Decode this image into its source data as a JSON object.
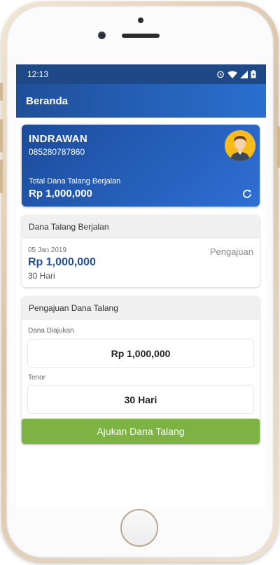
{
  "status_bar": {
    "time": "12:13"
  },
  "app_bar": {
    "title": "Beranda"
  },
  "profile": {
    "name": "INDRAWAN",
    "phone": "085280787860",
    "total_label": "Total Dana Talang Berjalan",
    "total_value": "Rp 1,000,000"
  },
  "running": {
    "header": "Dana Talang Berjalan",
    "date": "05 Jan 2019",
    "status": "Pengajuan",
    "amount": "Rp 1,000,000",
    "tenor": "30 Hari"
  },
  "application": {
    "header": "Pengajuan Dana Talang",
    "amount_label": "Dana Diajukan",
    "amount_value": "Rp 1,000,000",
    "tenor_label": "Tenor",
    "tenor_value": "30 Hari",
    "submit_label": "Ajukan Dana Talang"
  },
  "colors": {
    "status_bar": "#1e4886",
    "app_bar": "#2a6fcf",
    "accent": "#1f4f99",
    "submit": "#7cb342",
    "avatar_bg": "#f8bb1c"
  }
}
